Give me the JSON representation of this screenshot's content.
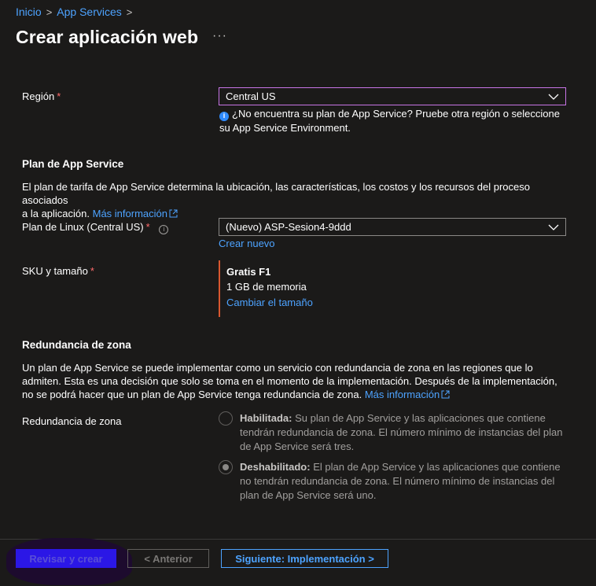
{
  "breadcrumb": {
    "items": [
      "Inicio",
      "App Services"
    ]
  },
  "title": "Crear aplicación web",
  "more": "···",
  "region": {
    "label": "Región",
    "required": "*",
    "value": "Central US",
    "info": "¿No encuentra su plan de App Service? Pruebe otra región o seleccione",
    "info2": "su App Service Environment."
  },
  "plan": {
    "section_title": "Plan de App Service",
    "description": "El plan de tarifa de App Service determina la ubicación, las características, los costos y los recursos del proceso asociados",
    "description2": "a la aplicación.",
    "more_info": "Más información",
    "linux_label": "Plan de Linux (Central US)",
    "linux_required": "*",
    "linux_value": "(Nuevo) ASP-Sesion4-9ddd",
    "create_new": "Crear nuevo",
    "sku_label": "SKU y tamaño",
    "sku_required": "*",
    "sku_name": "Gratis F1",
    "sku_memory": "1 GB de memoria",
    "sku_change": "Cambiar el tamaño"
  },
  "zone": {
    "section_title": "Redundancia de zona",
    "description": "Un plan de App Service se puede implementar como un servicio con redundancia de zona en las regiones que lo",
    "description2": "admiten. Esta es una decisión que solo se toma en el momento de la implementación. Después de la implementación,",
    "description3": "no se podrá hacer que un plan de App Service tenga redundancia de zona.",
    "more_info": "Más información",
    "label": "Redundancia de zona",
    "enabled_title": "Habilitada:",
    "enabled_text": "Su plan de App Service y las aplicaciones que contiene tendrán redundancia de zona. El número mínimo de instancias del plan de App Service será tres.",
    "disabled_title": "Deshabilitado:",
    "disabled_text": "El plan de App Service y las aplicaciones que contiene no tendrán redundancia de zona. El número mínimo de instancias del plan de App Service será uno.",
    "selected": "disabled"
  },
  "footer": {
    "review": "Revisar y crear",
    "previous": "< Anterior",
    "next": "Siguiente: Implementación >"
  }
}
